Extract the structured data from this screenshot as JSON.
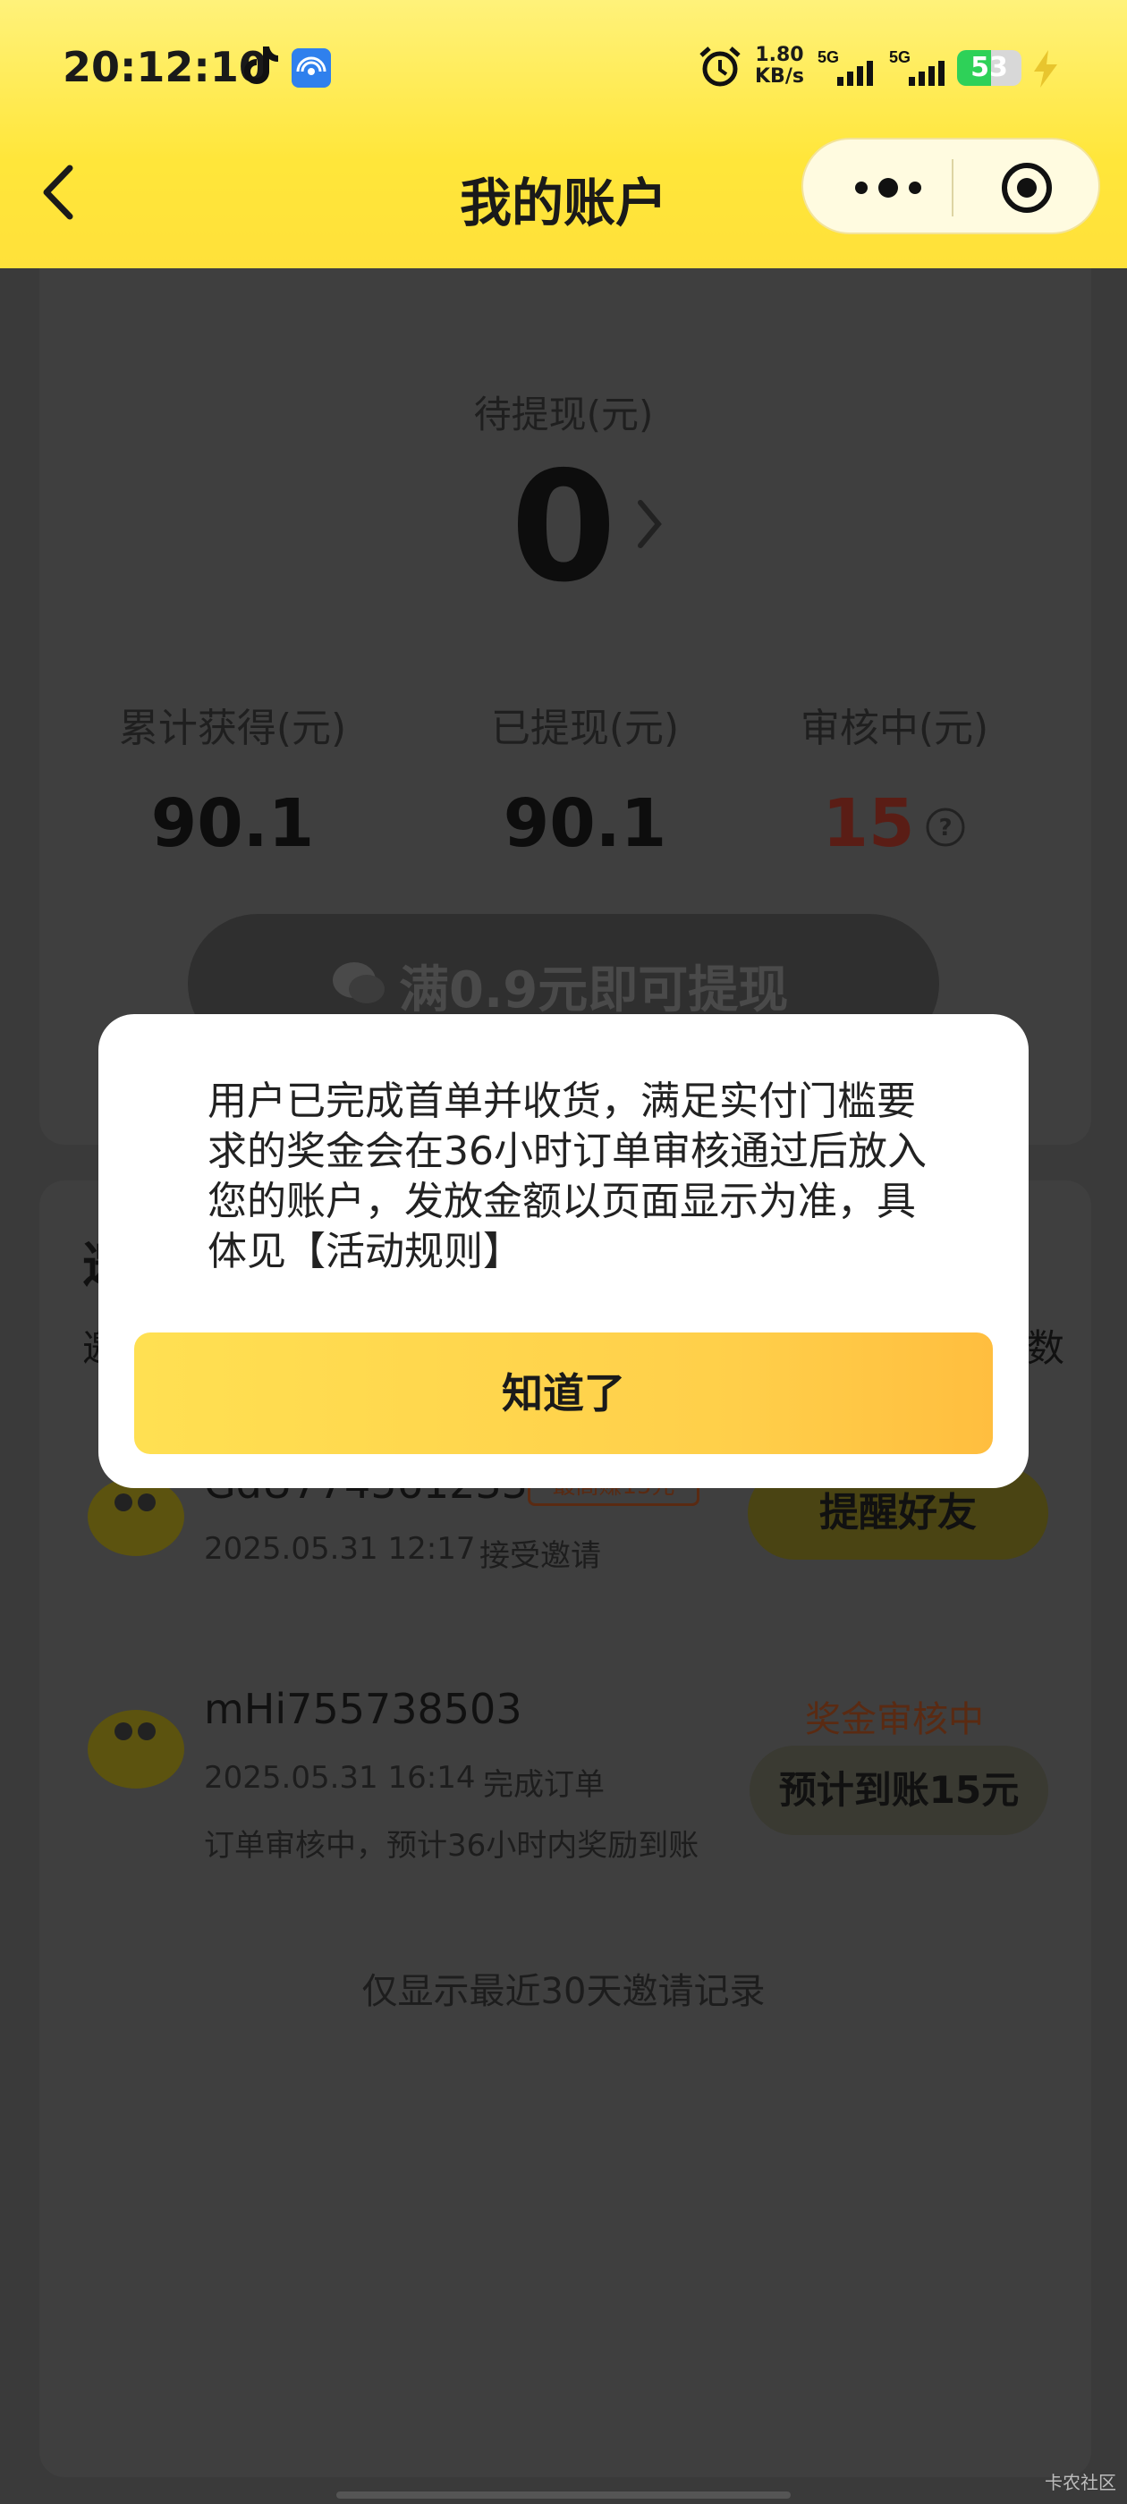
{
  "status_bar": {
    "time": "20:12:10",
    "net_speed_value": "1.80",
    "net_speed_unit": "KB/s",
    "signal_1": "5G",
    "signal_2": "5G",
    "battery": "53",
    "battery_level": 0.53,
    "icons": [
      "tiktok-icon",
      "cast-icon",
      "alarm-icon",
      "signal-icon",
      "battery-icon",
      "bolt-icon"
    ]
  },
  "header": {
    "title": "我的账户",
    "back_icon": "chevron-left-icon",
    "more_icon": "more-dots-icon",
    "close_icon": "target-circle-icon"
  },
  "account": {
    "pending_label": "待提现(元)",
    "pending_value": "0",
    "stats": [
      {
        "label": "累计获得(元)",
        "value": "90.1"
      },
      {
        "label": "已提现(元)",
        "value": "90.1"
      },
      {
        "label": "审核中(元)",
        "value": "15"
      }
    ],
    "withdraw_button": "满0.9元即可提现"
  },
  "invite": {
    "partial_title": "邀",
    "partial_sub_left": "邀",
    "partial_sub_right": "数",
    "rows": [
      {
        "name": "GdU774561233",
        "tag": "最高赚15元",
        "date": "2025.05.31 12:17",
        "status": "接受邀请",
        "button": "提醒好友"
      },
      {
        "name": "mHi755738503",
        "date": "2025.05.31 16:14",
        "status": "完成订单",
        "note": "订单审核中，预计36小时内奖励到账",
        "review": "奖金审核中",
        "button": "预计到账15元"
      }
    ],
    "footer": "仅显示最近30天邀请记录"
  },
  "dialog": {
    "message": "用户已完成首单并收货，满足实付门槛要求的奖金会在36小时订单审核通过后放入您的账户，发放金额以页面显示为准，具体见【活动规则】",
    "button": "知道了"
  },
  "watermark": "卡农社区",
  "colors": {
    "header_yellow": "#ffe63a",
    "overlay": "#3a3a3a",
    "button_gradient_start": "#ffe052",
    "button_gradient_end": "#ffbe3f",
    "battery_green": "#2ed158"
  }
}
